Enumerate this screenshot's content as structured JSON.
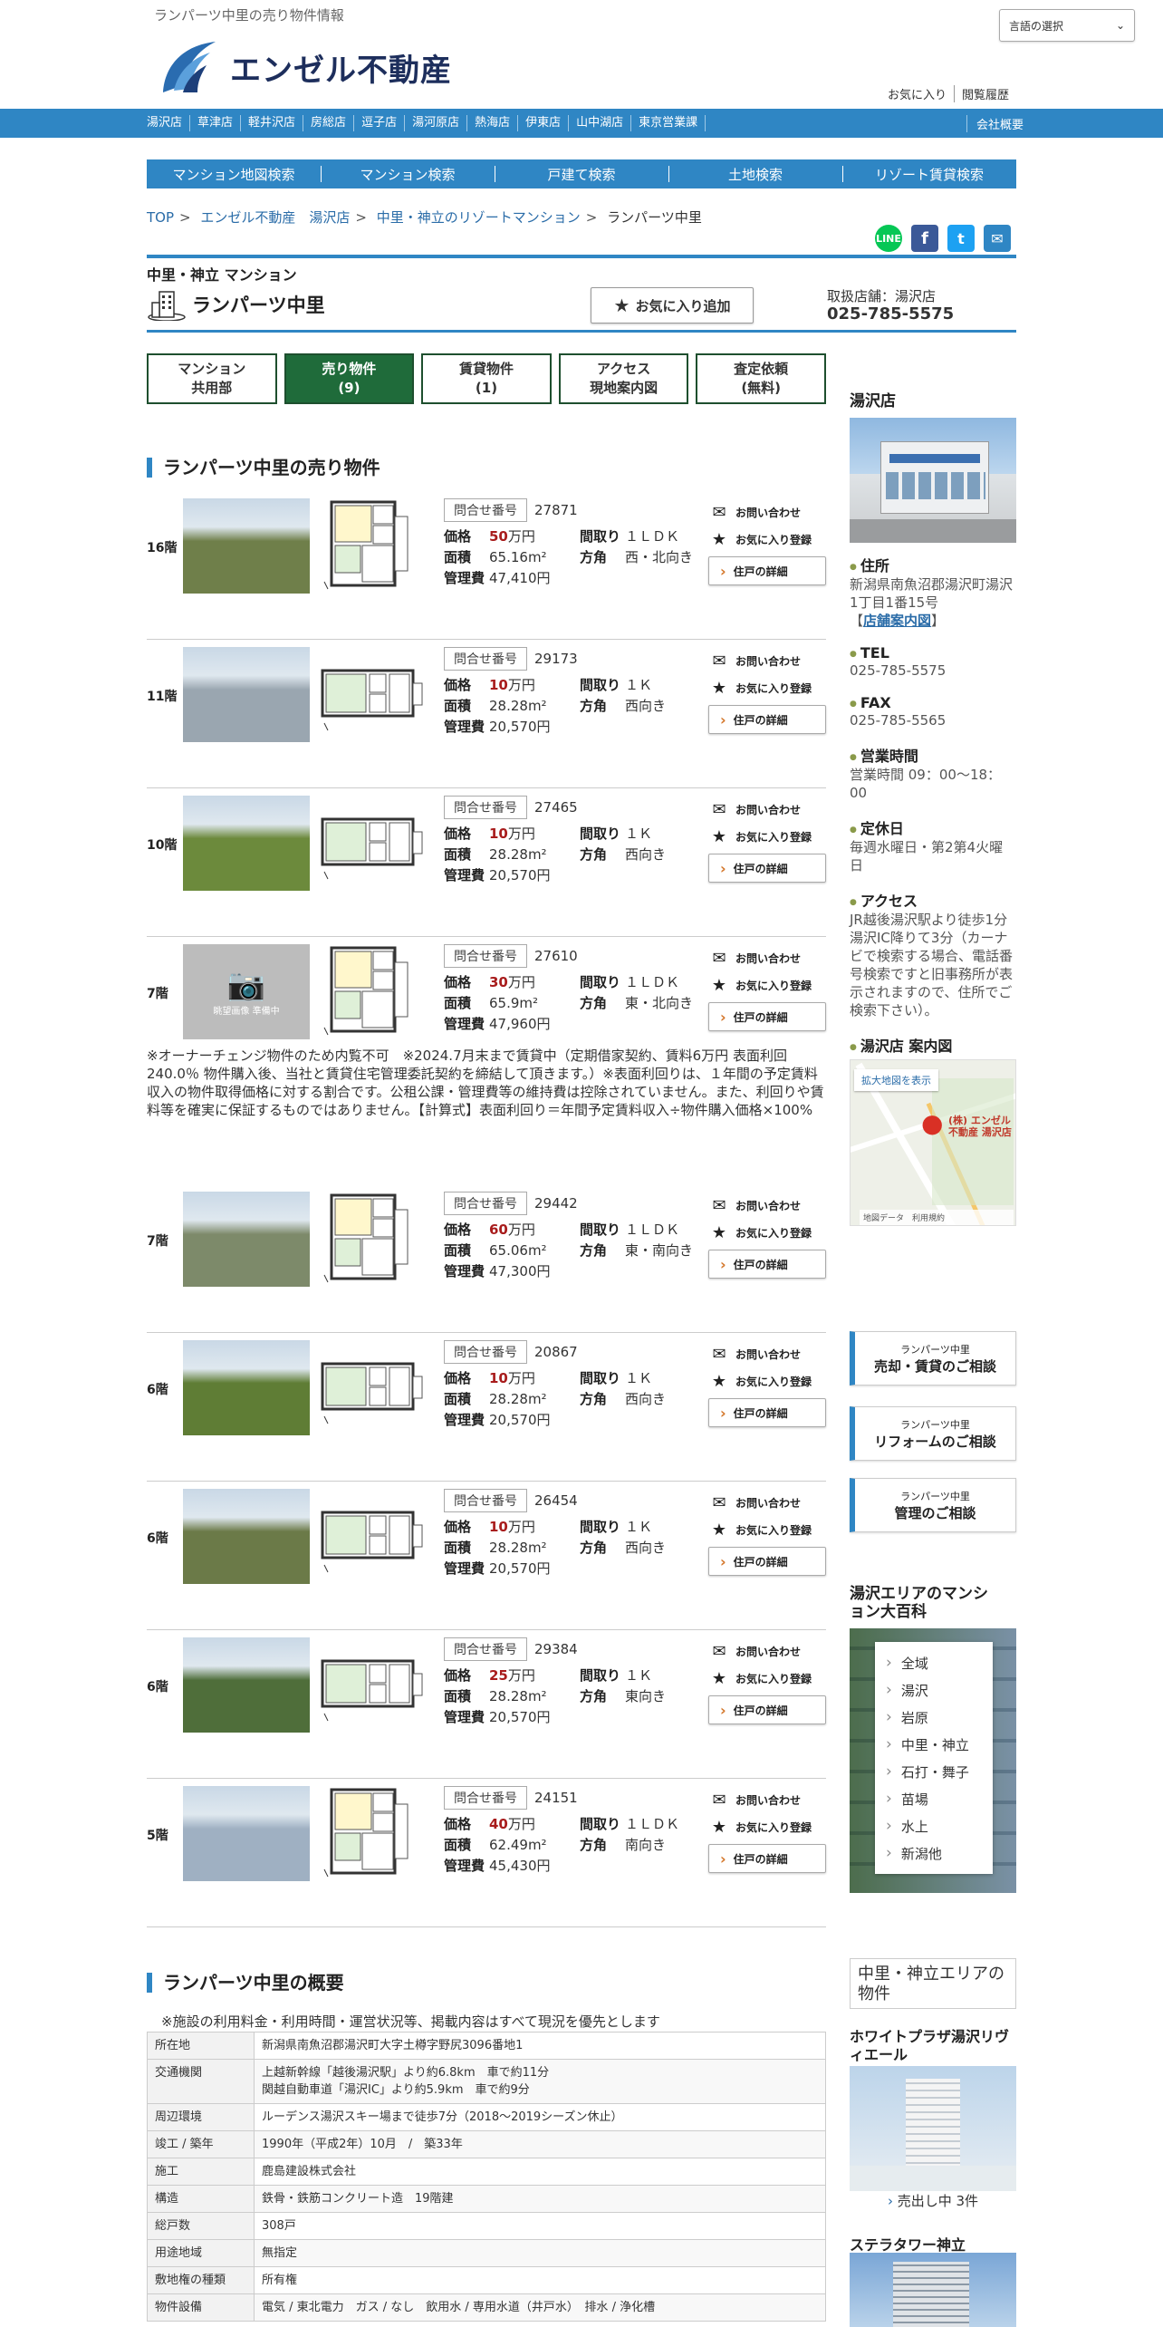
{
  "header": {
    "tagline": "ランパーツ中里の売り物件情報",
    "lang_select": "言語の選択",
    "logo_text": "エンゼル不動産",
    "links": [
      "お気に入り",
      "閲覧履歴"
    ]
  },
  "nav": {
    "stores": [
      "湯沢店",
      "草津店",
      "軽井沢店",
      "房総店",
      "逗子店",
      "湯河原店",
      "熱海店",
      "伊東店",
      "山中湖店",
      "東京営業課"
    ],
    "company": "会社概要"
  },
  "search_menu": [
    "マンション地図検索",
    "マンション検索",
    "戸建て検索",
    "土地検索",
    "リゾート賃貸検索"
  ],
  "breadcrumb": [
    "TOP",
    "エンゼル不動産　湯沢店",
    "中里・神立のリゾートマンション",
    "ランパーツ中里"
  ],
  "share": {
    "line": "LINE",
    "facebook": "f",
    "twitter": "t",
    "mail": "✉"
  },
  "property": {
    "category": "中里・神立 マンション",
    "name": "ランパーツ中里",
    "favorite_button": "お気に入り追加",
    "store_label": "取扱店舗：湯沢店",
    "store_tel": "025-785-5575"
  },
  "tabs": [
    {
      "line1": "マンション",
      "line2": "共用部"
    },
    {
      "line1": "売り物件",
      "line2": "(9)"
    },
    {
      "line1": "賃貸物件",
      "line2": "(1)"
    },
    {
      "line1": "アクセス",
      "line2": "現地案内図"
    },
    {
      "line1": "査定依頼",
      "line2": "(無料)"
    }
  ],
  "sale_section_title": "ランパーツ中里の売り物件",
  "labels": {
    "inquiry": "問合せ番号",
    "price": "価格",
    "layout": "間取り",
    "area": "面積",
    "direction": "方角",
    "fee": "管理費",
    "contact": "お問い合わせ",
    "fav": "お気に入り登録",
    "detail": "住戸の詳細",
    "man": "万円",
    "no_photo": "眺望画像 準備中"
  },
  "listings": [
    {
      "floor": "16階",
      "inq": "27871",
      "price": "50",
      "layout": "１ＬＤＫ",
      "area": "65.16m²",
      "dir": "西・北向き",
      "fee": "47,410円",
      "photo": "#6f7f4a"
    },
    {
      "floor": "11階",
      "inq": "29173",
      "price": "10",
      "layout": "１Ｋ",
      "area": "28.28m²",
      "dir": "西向き",
      "fee": "20,570円",
      "photo": "#9aa6b0"
    },
    {
      "floor": "10階",
      "inq": "27465",
      "price": "10",
      "layout": "１Ｋ",
      "area": "28.28m²",
      "dir": "西向き",
      "fee": "20,570円",
      "photo": "#6c8a3c"
    },
    {
      "floor": "7階",
      "inq": "27610",
      "price": "30",
      "layout": "１ＬＤＫ",
      "area": "65.9m²",
      "dir": "東・北向き",
      "fee": "47,960円",
      "photo": "#bcbcbc"
    },
    {
      "floor": "7階",
      "inq": "29442",
      "price": "60",
      "layout": "１ＬＤＫ",
      "area": "65.06m²",
      "dir": "東・南向き",
      "fee": "47,300円",
      "photo": "#7d8a6a"
    },
    {
      "floor": "6階",
      "inq": "20867",
      "price": "10",
      "layout": "１Ｋ",
      "area": "28.28m²",
      "dir": "西向き",
      "fee": "20,570円",
      "photo": "#5f7d35"
    },
    {
      "floor": "6階",
      "inq": "26454",
      "price": "10",
      "layout": "１Ｋ",
      "area": "28.28m²",
      "dir": "西向き",
      "fee": "20,570円",
      "photo": "#6b7a48"
    },
    {
      "floor": "6階",
      "inq": "29384",
      "price": "25",
      "layout": "１Ｋ",
      "area": "28.28m²",
      "dir": "東向き",
      "fee": "20,570円",
      "photo": "#4f6e3a"
    },
    {
      "floor": "5階",
      "inq": "24151",
      "price": "40",
      "layout": "１ＬＤＫ",
      "area": "62.49m²",
      "dir": "南向き",
      "fee": "45,430円",
      "photo": "#9fb0c2"
    }
  ],
  "note": "※オーナーチェンジ物件のため内覧不可　※2024.7月末まで賃貸中（定期借家契約、賃料6万円 表面利回240.0％ 物件購入後、当社と賃貸住宅管理委託契約を締結して頂きます。）※表面利回りは、１年間の予定賃料収入の物件取得価格に対する割合です。公租公課・管理費等の維持費は控除されていません。また、利回りや賃料等を確実に保証するものではありません。【計算式】表面利回り＝年間予定賃料収入÷物件購入価格×100%",
  "sidebar": {
    "store_title": "湯沢店",
    "address_label": "住所",
    "address": "新潟県南魚沼郡湯沢町湯沢1丁目1番15号",
    "store_map_link": "店舗案内図",
    "tel_label": "TEL",
    "tel": "025-785-5575",
    "fax_label": "FAX",
    "fax": "025-785-5565",
    "hours_label": "営業時間",
    "hours": "営業時間 09：00～18：00",
    "holiday_label": "定休日",
    "holiday": "毎週水曜日・第2第4火曜日",
    "access_label": "アクセス",
    "access": "JR越後湯沢駅より徒歩1分\n湯沢IC降りて3分（カーナビで検索する場合、電話番号検索ですと旧事務所が表示されますので、住所でご検索下さい）。",
    "map_title": "湯沢店 案内図",
    "map_expand": "拡大地図を表示",
    "map_pin": "(株) エンゼル不動産 湯沢店",
    "map_credit": "地図データ　利用規約",
    "consult": [
      {
        "small": "ランパーツ中里",
        "big": "売却・賃貸のご相談"
      },
      {
        "small": "ランパーツ中里",
        "big": "リフォームのご相談"
      },
      {
        "small": "ランパーツ中里",
        "big": "管理のご相談"
      }
    ],
    "encyclopedia_title": "湯沢エリアのマンション大百科",
    "areas": [
      "全域",
      "湯沢",
      "岩原",
      "中里・神立",
      "石打・舞子",
      "苗場",
      "水上",
      "新潟他"
    ],
    "area_props_title": "中里・神立エリアの物件",
    "nearby": [
      {
        "name": "ホワイトプラザ湯沢リヴィエール",
        "sub": "売出し中 3件"
      },
      {
        "name": "ステラタワー神立"
      }
    ]
  },
  "overview": {
    "title": "ランパーツ中里の概要",
    "note": "※施設の利用料金・利用時間・運営状況等、掲載内容はすべて現況を優先とします",
    "rows": [
      {
        "k": "所在地",
        "v": "新潟県南魚沼郡湯沢町大字土樽字野尻3096番地1"
      },
      {
        "k": "交通機関",
        "v": "上越新幹線「越後湯沢駅」より約6.8km　車で約11分\n関越自動車道「湯沢IC」より約5.9km　車で約9分"
      },
      {
        "k": "周辺環境",
        "v": "ルーデンス湯沢スキー場まで徒歩7分（2018～2019シーズン休止）"
      },
      {
        "k": "竣工 / 築年",
        "v": "1990年（平成2年）10月　/　築33年"
      },
      {
        "k": "施工",
        "v": "鹿島建設株式会社"
      },
      {
        "k": "構造",
        "v": "鉄骨・鉄筋コンクリート造　19階建"
      },
      {
        "k": "総戸数",
        "v": "308戸"
      },
      {
        "k": "用途地域",
        "v": "無指定"
      },
      {
        "k": "敷地権の種類",
        "v": "所有権"
      },
      {
        "k": "物件設備",
        "v": "電気 / 東北電力　ガス / なし　飲用水 / 専用水道（井戸水）　排水 / 浄化槽"
      }
    ]
  },
  "colors": {
    "accent": "#2f86c4",
    "tab_active": "#1f6b3a",
    "price": "#a81c1c"
  }
}
